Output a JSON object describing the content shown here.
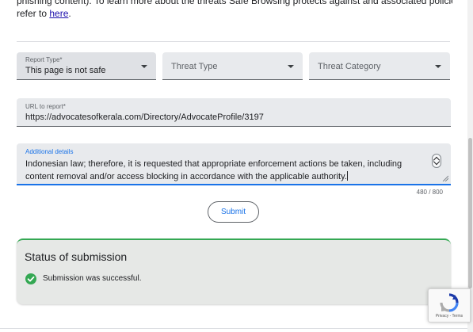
{
  "intro": {
    "line1_part1": "phishing content). To learn more about the threats Safe Browsing protects against and associated policies, please",
    "line2_prefix": "refer to ",
    "link_text": "here",
    "line2_suffix": "."
  },
  "form": {
    "report_type": {
      "label": "Report Type*",
      "value": "This page is not safe"
    },
    "threat_type": {
      "placeholder": "Threat Type"
    },
    "threat_category": {
      "placeholder": "Threat Category"
    },
    "url": {
      "label": "URL to report*",
      "value": "https://advocatesofkerala.com/Directory/AdvocateProfile/3197"
    },
    "details": {
      "label": "Additional details",
      "line1": "Indonesian law; therefore, it is requested that appropriate enforcement actions be taken, including",
      "line2": "content removal and/or access blocking in accordance with the applicable authority."
    },
    "counter": "480 / 800",
    "submit_label": "Submit"
  },
  "status": {
    "title": "Status of submission",
    "message": "Submission was successful.",
    "icon": "check-circle-icon",
    "color": "#34a853"
  },
  "recaptcha": {
    "footer": "Privacy - Terms",
    "icon": "recaptcha-logo-icon"
  },
  "colors": {
    "accent": "#1a73e8",
    "success": "#34a853",
    "link": "#1a0dab"
  }
}
